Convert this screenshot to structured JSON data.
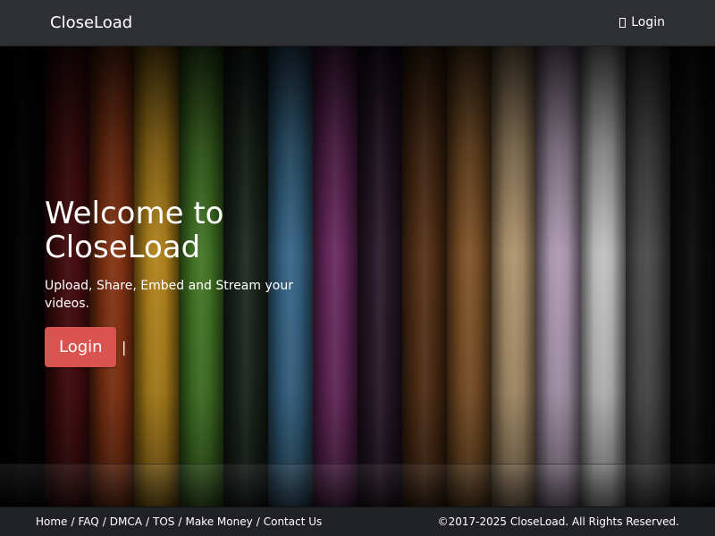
{
  "navbar": {
    "brand": "CloseLoad",
    "login_label": "Login",
    "login_icon": "sign-in-icon"
  },
  "hero": {
    "title": "Welcome to CloseLoad",
    "subtitle": "Upload, Share, Embed and Stream your videos.",
    "login_button": "Login",
    "separator": "|",
    "stripe_colors": [
      "#0b0b0c",
      "#8b1a20",
      "#b8471a",
      "#d9a020",
      "#4e8a2a",
      "#1f2a22",
      "#3a6f93",
      "#6e2a63",
      "#2a1a2a",
      "#5a3318",
      "#8b5a2a",
      "#c4a57a",
      "#c8b2cc",
      "#e4e4e4",
      "#6f6f6f",
      "#1b1b1b"
    ]
  },
  "footer": {
    "links": [
      "Home",
      "FAQ",
      "DMCA",
      "TOS",
      "Make Money",
      "Contact Us"
    ],
    "link_separator": "/",
    "copyright": "©2017-2025 CloseLoad. All Rights Reserved."
  },
  "colors": {
    "navbar_bg": "#2d2f33",
    "footer_bg": "#202124",
    "button_red": "#d9534f"
  }
}
